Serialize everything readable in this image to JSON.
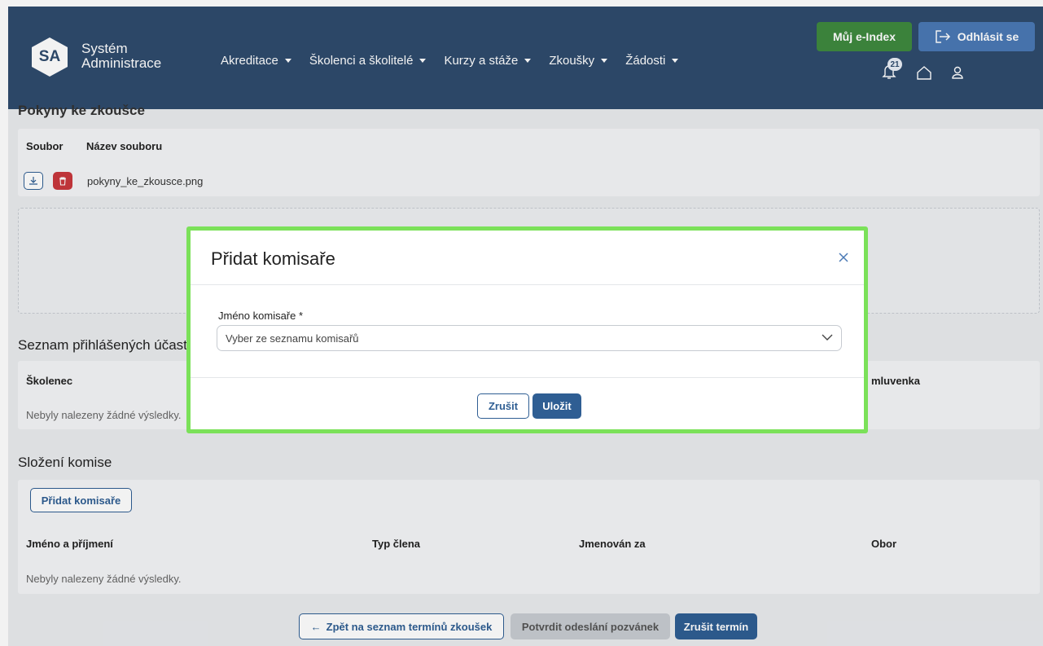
{
  "header": {
    "logo_abbr": "SA",
    "logo_line1": "Systém",
    "logo_line2": "Administrace",
    "nav": [
      "Akreditace",
      "Školenci a školitelé",
      "Kurzy a stáže",
      "Zkoušky",
      "Žádosti"
    ],
    "eindex_label": "Můj e-Index",
    "logout_label": "Odhlásit se",
    "notification_count": "21"
  },
  "instructions": {
    "title": "Pokyny ke zkoušce",
    "col_file": "Soubor",
    "col_name": "Název souboru",
    "file_name": "pokyny_ke_zkousce.png"
  },
  "participants": {
    "title": "Seznam přihlášených účastníků",
    "col_trainee": "Školenec",
    "col_contract": "mluvenka",
    "empty": "Nebyly nalezeny žádné výsledky."
  },
  "committee": {
    "title": "Složení komise",
    "add_button": "Přidat komisaře",
    "col_name": "Jméno a příjmení",
    "col_type": "Typ člena",
    "col_appointed": "Jmenován za",
    "col_field": "Obor",
    "empty": "Nebyly nalezeny žádné výsledky."
  },
  "footer_actions": {
    "back": "Zpět na seznam termínů zkoušek",
    "confirm": "Potvrdit odeslání pozvánek",
    "cancel_term": "Zrušit termín"
  },
  "modal": {
    "title": "Přidat komisaře",
    "field_label": "Jméno komisaře *",
    "select_placeholder": "Vyber ze seznamu komisařů",
    "cancel": "Zrušit",
    "save": "Uložit"
  },
  "colors": {
    "header_bg": "#2f4b6d",
    "primary": "#2f5e93",
    "success": "#3f8a3f",
    "danger": "#c9373d",
    "modal_highlight": "#7be159"
  }
}
